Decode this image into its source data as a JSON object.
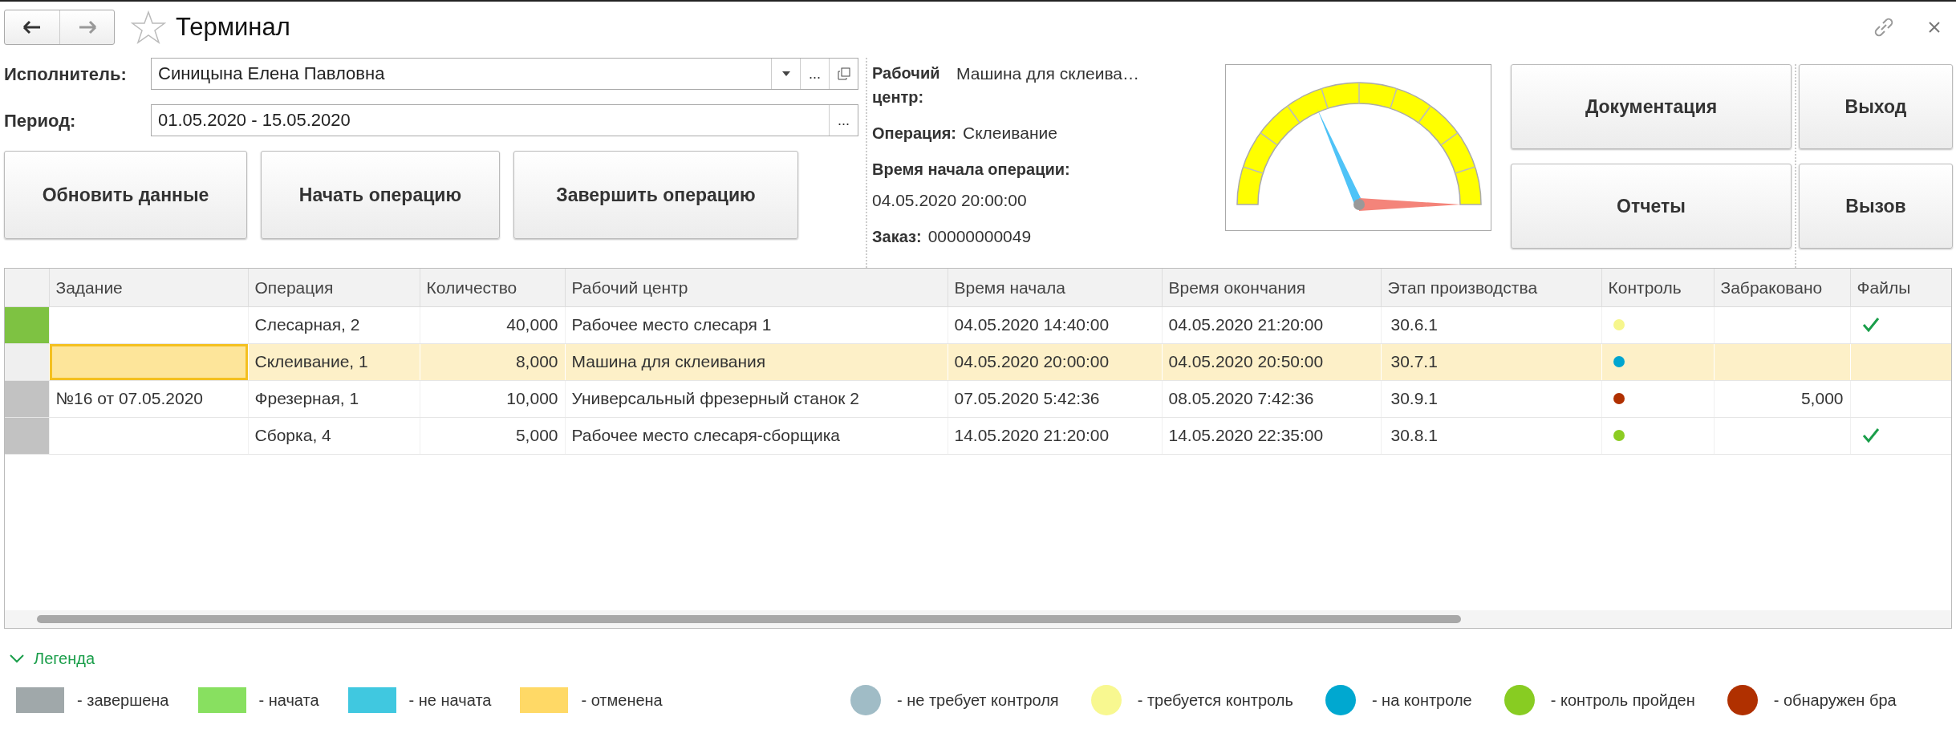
{
  "window": {
    "title": "Терминал"
  },
  "form": {
    "executor": {
      "label": "Исполнитель:",
      "value": "Синицына Елена Павловна",
      "more": "..."
    },
    "period": {
      "label": "Период:",
      "value": "01.05.2020 - 15.05.2020",
      "more": "..."
    },
    "actions": [
      "Обновить данные",
      "Начать операцию",
      "Завершить операцию"
    ]
  },
  "info": {
    "work_center_label": "Рабочий центр:",
    "work_center": "Машина для склеива…",
    "operation_label": "Операция:",
    "operation": "Склеивание",
    "start_label": "Время начала операции:",
    "start": "04.05.2020 20:00:00",
    "order_label": "Заказ:",
    "order": "00000000049"
  },
  "side_buttons": [
    [
      "Документация",
      "Отчеты"
    ],
    [
      "Выход",
      "Вызов"
    ]
  ],
  "table": {
    "columns": [
      "Задание",
      "Операция",
      "Количество",
      "Рабочий центр",
      "Время начала",
      "Время окончания",
      "Этап производства",
      "Контроль",
      "Забраковано",
      "Файлы"
    ],
    "rows": [
      {
        "color": "#7ec242",
        "task": "",
        "operation": "Слесарная, 2",
        "quantity": "40,000",
        "work_center": "Рабочее место слесаря 1",
        "start": "04.05.2020 14:40:00",
        "end": "04.05.2020 21:20:00",
        "stage": "30.6.1",
        "control": {
          "color": "#f6f68c"
        },
        "rejected": "",
        "files": true,
        "selected": false
      },
      {
        "color": "#efefef",
        "task": "",
        "operation": "Склеивание, 1",
        "quantity": "8,000",
        "work_center": "Машина для склеивания",
        "start": "04.05.2020 20:00:00",
        "end": "04.05.2020 20:50:00",
        "stage": "30.7.1",
        "control": {
          "color": "#00a5d0"
        },
        "rejected": "",
        "files": false,
        "selected": true
      },
      {
        "color": "#c2c2c2",
        "task": "№16 от 07.05.2020",
        "operation": "Фрезерная, 1",
        "quantity": "10,000",
        "work_center": "Универсальный фрезерный станок 2",
        "start": "07.05.2020 5:42:36",
        "end": "08.05.2020 7:42:36",
        "stage": "30.9.1",
        "control": {
          "color": "#b03000"
        },
        "rejected": "5,000",
        "files": false,
        "selected": false
      },
      {
        "color": "#c2c2c2",
        "task": "",
        "operation": "Сборка, 4",
        "quantity": "5,000",
        "work_center": "Рабочее место слесаря-сборщика",
        "start": "14.05.2020 21:20:00",
        "end": "14.05.2020 22:35:00",
        "stage": "30.8.1",
        "control": {
          "color": "#8ccc22"
        },
        "rejected": "",
        "files": true,
        "selected": false
      }
    ]
  },
  "legend": {
    "title": "Легенда",
    "expanded": true,
    "status": [
      {
        "label": "- завершена",
        "color": "#a0a8aa"
      },
      {
        "label": "- начата",
        "color": "#88e060"
      },
      {
        "label": "- не начата",
        "color": "#40c8e0"
      },
      {
        "label": "- отменена",
        "color": "#ffd966"
      }
    ],
    "control": [
      {
        "label": "- не требует контроля",
        "color": "#a0bcc6"
      },
      {
        "label": "- требуется контроль",
        "color": "#f8f890"
      },
      {
        "label": "- на контроле",
        "color": "#00a8d0"
      },
      {
        "label": "- контроль пройден",
        "color": "#88cc22"
      },
      {
        "label": "- обнаружен бра",
        "color": "#b03000"
      }
    ]
  }
}
